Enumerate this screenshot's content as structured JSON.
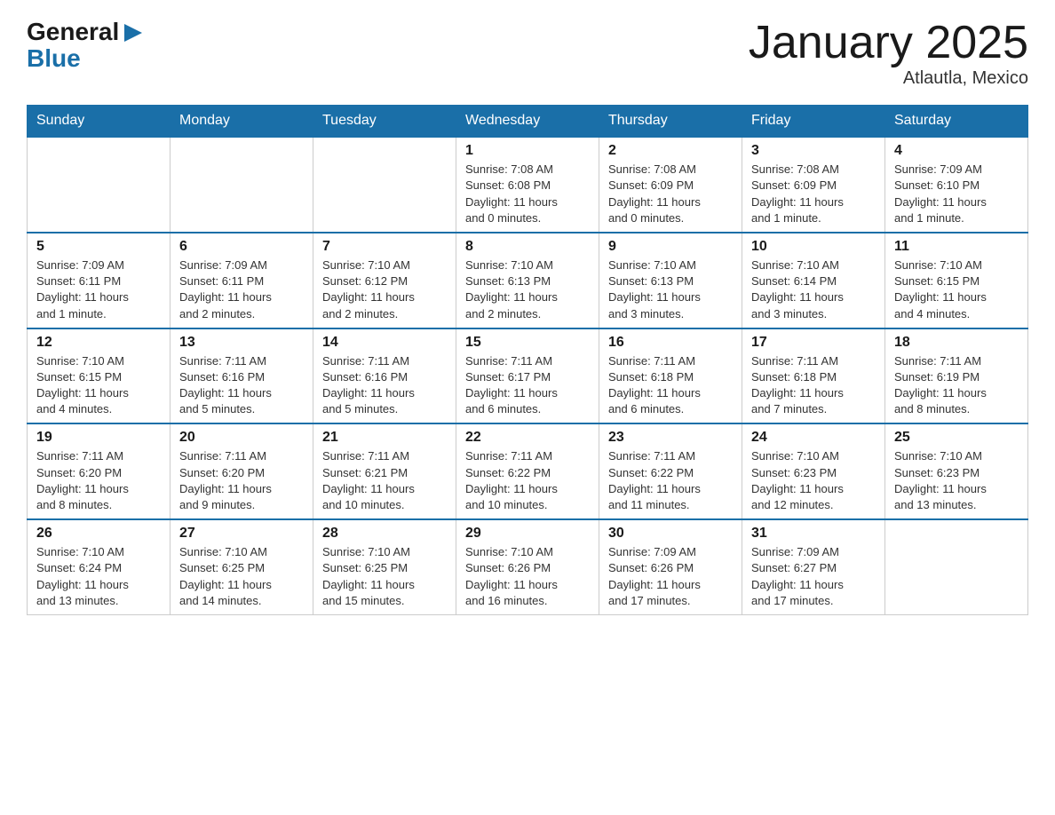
{
  "logo": {
    "general_text": "General",
    "blue_text": "Blue"
  },
  "title": "January 2025",
  "location": "Atlautla, Mexico",
  "days_of_week": [
    "Sunday",
    "Monday",
    "Tuesday",
    "Wednesday",
    "Thursday",
    "Friday",
    "Saturday"
  ],
  "weeks": [
    [
      {
        "day": "",
        "info": ""
      },
      {
        "day": "",
        "info": ""
      },
      {
        "day": "",
        "info": ""
      },
      {
        "day": "1",
        "info": "Sunrise: 7:08 AM\nSunset: 6:08 PM\nDaylight: 11 hours\nand 0 minutes."
      },
      {
        "day": "2",
        "info": "Sunrise: 7:08 AM\nSunset: 6:09 PM\nDaylight: 11 hours\nand 0 minutes."
      },
      {
        "day": "3",
        "info": "Sunrise: 7:08 AM\nSunset: 6:09 PM\nDaylight: 11 hours\nand 1 minute."
      },
      {
        "day": "4",
        "info": "Sunrise: 7:09 AM\nSunset: 6:10 PM\nDaylight: 11 hours\nand 1 minute."
      }
    ],
    [
      {
        "day": "5",
        "info": "Sunrise: 7:09 AM\nSunset: 6:11 PM\nDaylight: 11 hours\nand 1 minute."
      },
      {
        "day": "6",
        "info": "Sunrise: 7:09 AM\nSunset: 6:11 PM\nDaylight: 11 hours\nand 2 minutes."
      },
      {
        "day": "7",
        "info": "Sunrise: 7:10 AM\nSunset: 6:12 PM\nDaylight: 11 hours\nand 2 minutes."
      },
      {
        "day": "8",
        "info": "Sunrise: 7:10 AM\nSunset: 6:13 PM\nDaylight: 11 hours\nand 2 minutes."
      },
      {
        "day": "9",
        "info": "Sunrise: 7:10 AM\nSunset: 6:13 PM\nDaylight: 11 hours\nand 3 minutes."
      },
      {
        "day": "10",
        "info": "Sunrise: 7:10 AM\nSunset: 6:14 PM\nDaylight: 11 hours\nand 3 minutes."
      },
      {
        "day": "11",
        "info": "Sunrise: 7:10 AM\nSunset: 6:15 PM\nDaylight: 11 hours\nand 4 minutes."
      }
    ],
    [
      {
        "day": "12",
        "info": "Sunrise: 7:10 AM\nSunset: 6:15 PM\nDaylight: 11 hours\nand 4 minutes."
      },
      {
        "day": "13",
        "info": "Sunrise: 7:11 AM\nSunset: 6:16 PM\nDaylight: 11 hours\nand 5 minutes."
      },
      {
        "day": "14",
        "info": "Sunrise: 7:11 AM\nSunset: 6:16 PM\nDaylight: 11 hours\nand 5 minutes."
      },
      {
        "day": "15",
        "info": "Sunrise: 7:11 AM\nSunset: 6:17 PM\nDaylight: 11 hours\nand 6 minutes."
      },
      {
        "day": "16",
        "info": "Sunrise: 7:11 AM\nSunset: 6:18 PM\nDaylight: 11 hours\nand 6 minutes."
      },
      {
        "day": "17",
        "info": "Sunrise: 7:11 AM\nSunset: 6:18 PM\nDaylight: 11 hours\nand 7 minutes."
      },
      {
        "day": "18",
        "info": "Sunrise: 7:11 AM\nSunset: 6:19 PM\nDaylight: 11 hours\nand 8 minutes."
      }
    ],
    [
      {
        "day": "19",
        "info": "Sunrise: 7:11 AM\nSunset: 6:20 PM\nDaylight: 11 hours\nand 8 minutes."
      },
      {
        "day": "20",
        "info": "Sunrise: 7:11 AM\nSunset: 6:20 PM\nDaylight: 11 hours\nand 9 minutes."
      },
      {
        "day": "21",
        "info": "Sunrise: 7:11 AM\nSunset: 6:21 PM\nDaylight: 11 hours\nand 10 minutes."
      },
      {
        "day": "22",
        "info": "Sunrise: 7:11 AM\nSunset: 6:22 PM\nDaylight: 11 hours\nand 10 minutes."
      },
      {
        "day": "23",
        "info": "Sunrise: 7:11 AM\nSunset: 6:22 PM\nDaylight: 11 hours\nand 11 minutes."
      },
      {
        "day": "24",
        "info": "Sunrise: 7:10 AM\nSunset: 6:23 PM\nDaylight: 11 hours\nand 12 minutes."
      },
      {
        "day": "25",
        "info": "Sunrise: 7:10 AM\nSunset: 6:23 PM\nDaylight: 11 hours\nand 13 minutes."
      }
    ],
    [
      {
        "day": "26",
        "info": "Sunrise: 7:10 AM\nSunset: 6:24 PM\nDaylight: 11 hours\nand 13 minutes."
      },
      {
        "day": "27",
        "info": "Sunrise: 7:10 AM\nSunset: 6:25 PM\nDaylight: 11 hours\nand 14 minutes."
      },
      {
        "day": "28",
        "info": "Sunrise: 7:10 AM\nSunset: 6:25 PM\nDaylight: 11 hours\nand 15 minutes."
      },
      {
        "day": "29",
        "info": "Sunrise: 7:10 AM\nSunset: 6:26 PM\nDaylight: 11 hours\nand 16 minutes."
      },
      {
        "day": "30",
        "info": "Sunrise: 7:09 AM\nSunset: 6:26 PM\nDaylight: 11 hours\nand 17 minutes."
      },
      {
        "day": "31",
        "info": "Sunrise: 7:09 AM\nSunset: 6:27 PM\nDaylight: 11 hours\nand 17 minutes."
      },
      {
        "day": "",
        "info": ""
      }
    ]
  ]
}
